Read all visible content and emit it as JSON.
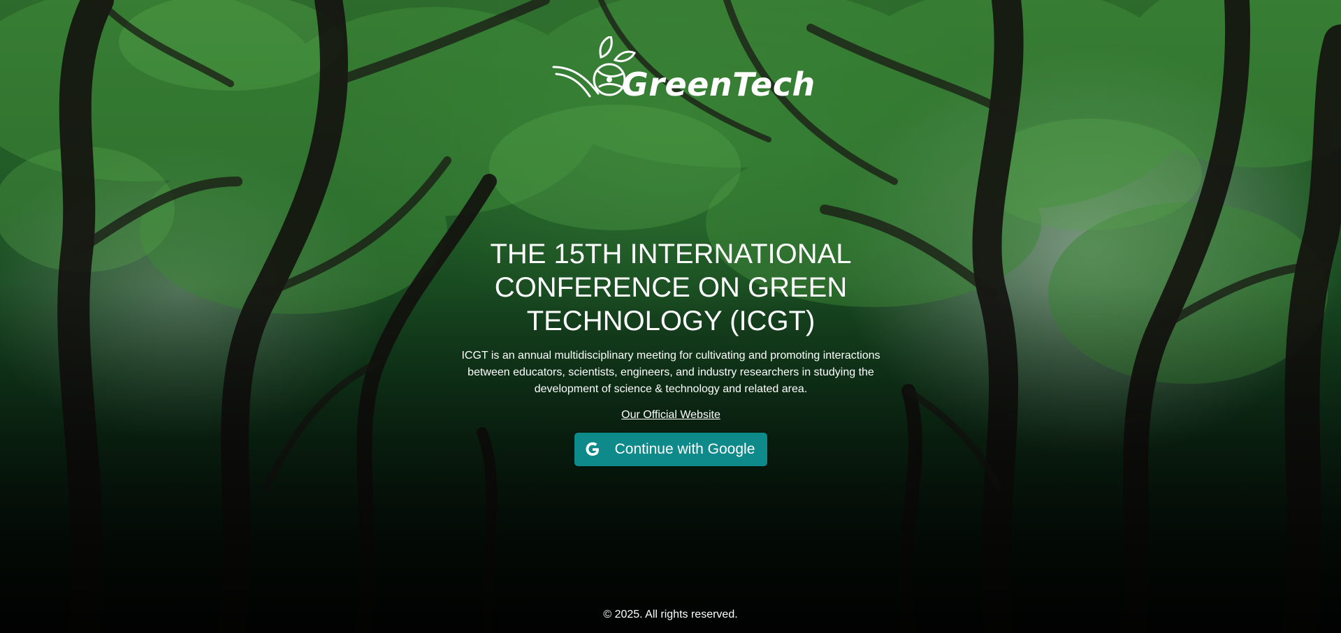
{
  "logo": {
    "text": "GreenTech",
    "icon": "leaf-globe-icon"
  },
  "hero": {
    "title": "THE 15TH INTERNATIONAL CONFERENCE ON GREEN TECHNOLOGY (ICGT)",
    "description": "ICGT is an annual multidisciplinary meeting for cultivating and promoting interactions between educators, scientists, engineers, and industry researchers in studying the development of science & technology and related area.",
    "website_link": "Our Official Website",
    "google_button": "Continue with Google",
    "google_icon": "google-g-icon"
  },
  "footer": {
    "copyright": "© 2025. All rights reserved."
  },
  "colors": {
    "accent": "#0f8a8a",
    "forest_dark": "#0a2112",
    "text": "#ffffff"
  }
}
